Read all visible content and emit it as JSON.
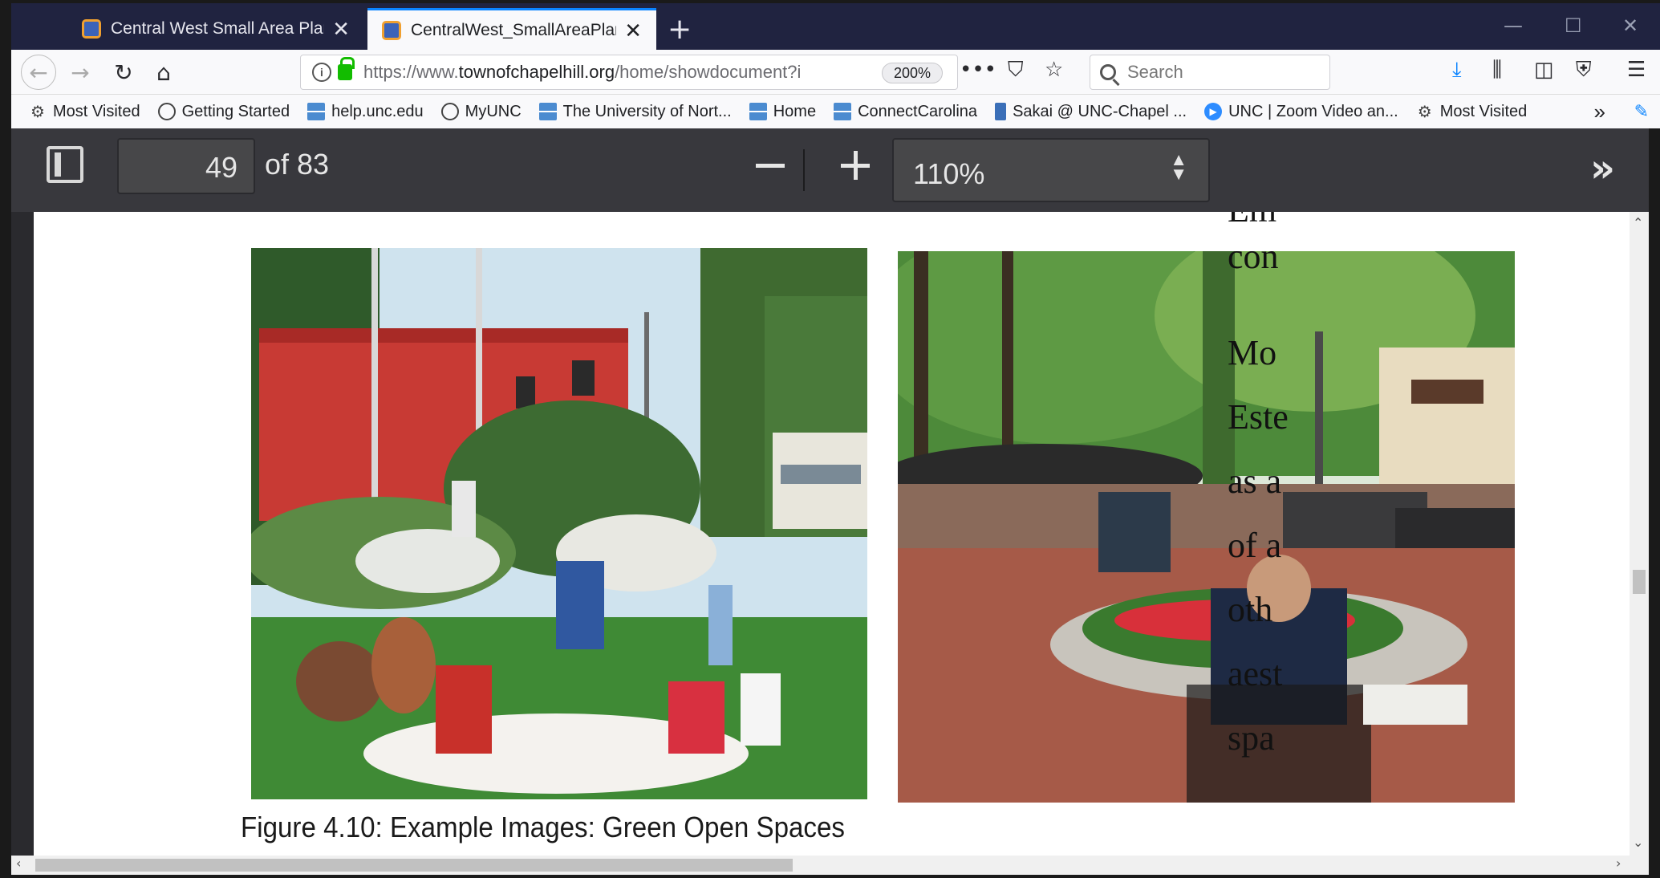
{
  "tabs": [
    {
      "title": "Central West Small Area Plan |",
      "close": "✕"
    },
    {
      "title": "CentralWest_SmallAreaPlan_20",
      "close": "✕"
    }
  ],
  "new_tab": "+",
  "address_bar": {
    "url_prefix": "https://www.",
    "url_domain": "townofchapelhill.org",
    "url_path": "/home/showdocument?i",
    "zoom": "200%"
  },
  "search": {
    "placeholder": "Search"
  },
  "bookmarks": [
    {
      "label": "Most Visited",
      "icon": "gear-icon"
    },
    {
      "label": "Getting Started",
      "icon": "globe-icon"
    },
    {
      "label": "help.unc.edu",
      "icon": "unc-icon"
    },
    {
      "label": "MyUNC",
      "icon": "globe-icon"
    },
    {
      "label": "The University of Nort...",
      "icon": "unc-icon"
    },
    {
      "label": "Home",
      "icon": "unc-icon"
    },
    {
      "label": "ConnectCarolina",
      "icon": "unc-icon"
    },
    {
      "label": "Sakai @ UNC-Chapel ...",
      "icon": "sakai-icon"
    },
    {
      "label": "UNC | Zoom Video an...",
      "icon": "zoom-icon"
    },
    {
      "label": "Most Visited",
      "icon": "gear-icon"
    }
  ],
  "pdf_toolbar": {
    "page_number": "49",
    "page_count": "of 83",
    "scale": "110%"
  },
  "document": {
    "caption": "Figure 4.10:  Example Images: Green Open Spaces",
    "side_text": [
      "con",
      "Mo",
      "Este",
      "as a",
      "of a",
      "oth",
      "aest",
      "spa"
    ]
  }
}
